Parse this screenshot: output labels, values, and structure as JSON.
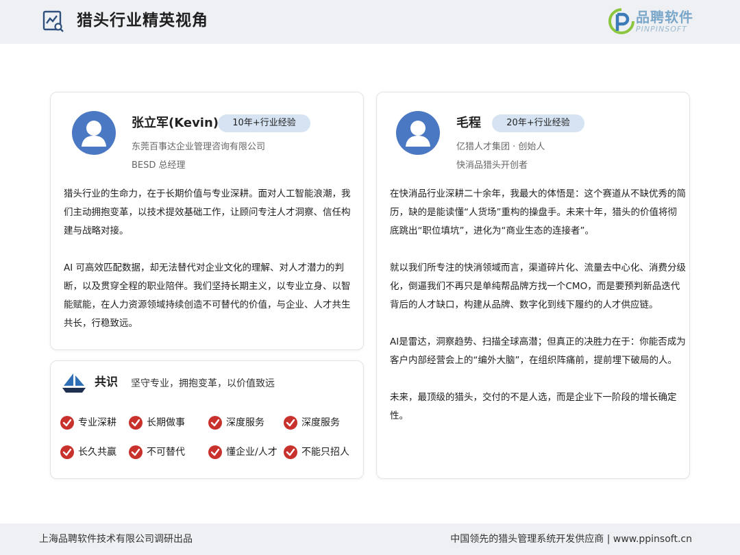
{
  "header": {
    "title": "猎头行业精英视角",
    "brand_name": "品聘软件",
    "brand_sub": "PINPINSOFT",
    "icon": "chart-analysis-icon",
    "background": "#eef0f3"
  },
  "experts": [
    {
      "name": "张立军(Kevin)",
      "badge": "10年+行业经验",
      "company": "东莞百事达企业管理咨询有限公司",
      "role": "BESD 总经理",
      "paragraphs": [
        "猎头行业的生命力，在于长期价值与专业深耕。面对人工智能浪潮，我们主动拥抱变革，以技术提效基础工作，让顾问专注人才洞察、信任构建与战略对接。",
        "AI 可高效匹配数据，却无法替代对企业文化的理解、对人才潜力的判断，以及贯穿全程的职业陪伴。我们坚持长期主义，以专业立身、以智能赋能，在人力资源领域持续创造不可替代的价值，与企业、人才共生共长，行稳致远。"
      ]
    },
    {
      "name": "毛程",
      "badge": "20年+行业经验",
      "company": "亿猎人才集团 · 创始人",
      "role": "快消品猎头开创者",
      "paragraphs": [
        "在快消品行业深耕二十余年，我最大的体悟是：这个赛道从不缺优秀的简历，缺的是能读懂“人货场”重构的操盘手。未来十年，猎头的价值将彻底跳出“职位填坑”，进化为“商业生态的连接者”。",
        "就以我们所专注的快消领域而言，渠道碎片化、流量去中心化、消费分级化，倒逼我们不再只是单纯帮品牌方找一个CMO，而是要预判新品迭代背后的人才缺口，构建从品牌、数字化到线下履约的人才供应链。",
        "AI是雷达，洞察趋势、扫描全球高潜；但真正的决胜力在于：你能否成为客户内部经营会上的“编外大脑”，在组织阵痛前，提前埋下破局的人。",
        "未来，最顶级的猎头，交付的不是人选，而是企业下一阶段的增长确定性。"
      ]
    }
  ],
  "consensus": {
    "title": "共识",
    "text": "坚守专业，拥抱变革，以价值致远",
    "icon": "sailboat-icon",
    "items": [
      "专业深耕",
      "长期做事",
      "深度服务",
      "深度服务",
      "长久共赢",
      "不可替代",
      "懂企业/人才",
      "不能只招人"
    ]
  },
  "footer": {
    "left": "上海品聘软件技术有限公司调研出品",
    "right": "中国领先的猎头管理系统开发供应商 | www.ppinsoft.cn"
  },
  "colors": {
    "accent_blue": "#4a78c2",
    "badge_bg": "#d6e3f3",
    "check_red": "#c9312c"
  }
}
